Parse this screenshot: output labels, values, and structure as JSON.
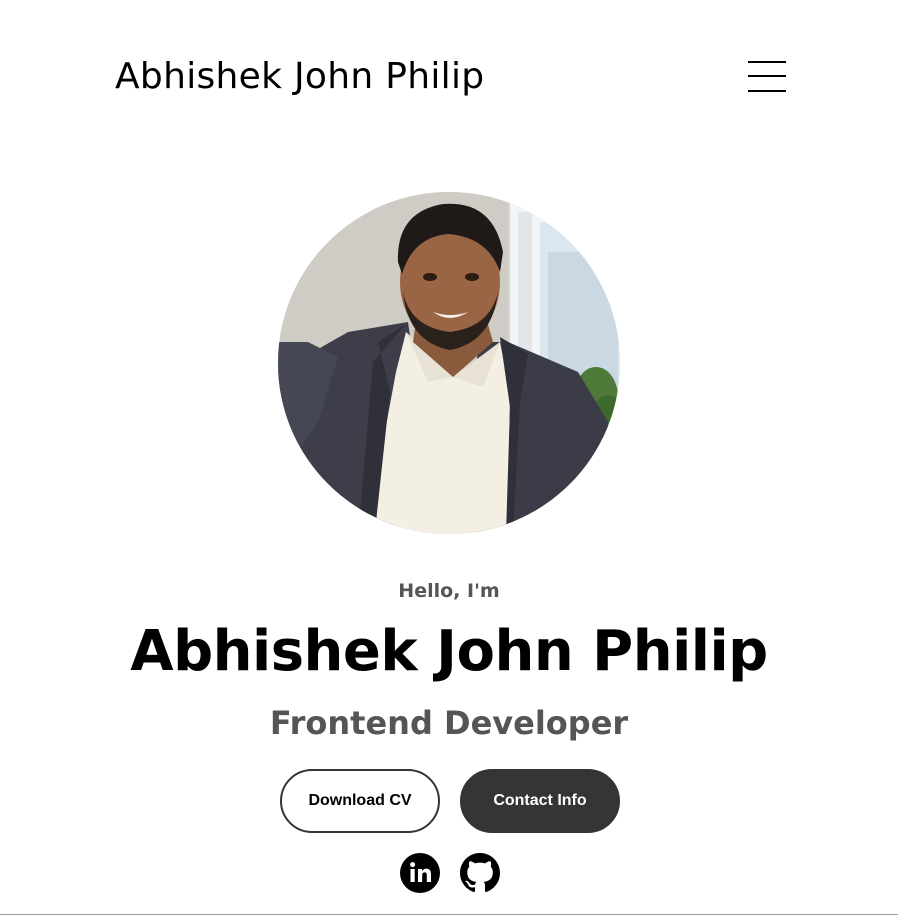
{
  "header": {
    "site_name": "Abhishek John Philip",
    "menu_icon": "hamburger-menu-icon"
  },
  "profile": {
    "photo_alt": "Profile picture"
  },
  "hero": {
    "greeting": "Hello, I'm",
    "name": "Abhishek John Philip",
    "role": "Frontend Developer"
  },
  "buttons": {
    "download_cv": "Download CV",
    "contact_info": "Contact Info"
  },
  "socials": [
    {
      "name": "LinkedIn",
      "icon": "linkedin-icon"
    },
    {
      "name": "GitHub",
      "icon": "github-icon"
    }
  ],
  "colors": {
    "text_primary": "#000000",
    "text_secondary": "#555555",
    "button_dark": "#353535",
    "background": "#ffffff"
  }
}
